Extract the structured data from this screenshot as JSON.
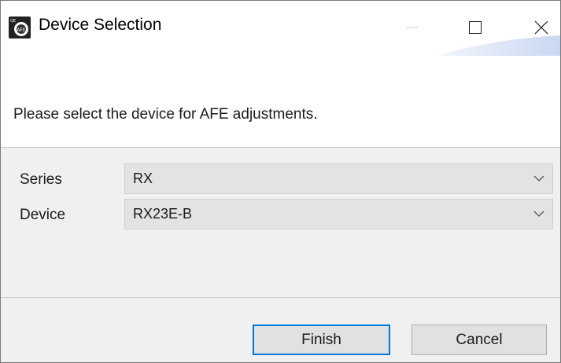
{
  "window": {
    "title": "Device Selection",
    "app_icon": "afe-tool-icon",
    "controls": {
      "minimize": "minimize-icon",
      "maximize": "maximize-icon",
      "close": "close-icon"
    }
  },
  "header": {
    "instruction": "Please select the device for AFE adjustments."
  },
  "form": {
    "series_label": "Series",
    "series_value": "RX",
    "device_label": "Device",
    "device_value": "RX23E-B"
  },
  "footer": {
    "finish_label": "Finish",
    "cancel_label": "Cancel"
  },
  "colors": {
    "focus_border": "#0078d7",
    "panel_bg": "#f0f0f0",
    "combo_bg": "#e3e3e3"
  }
}
